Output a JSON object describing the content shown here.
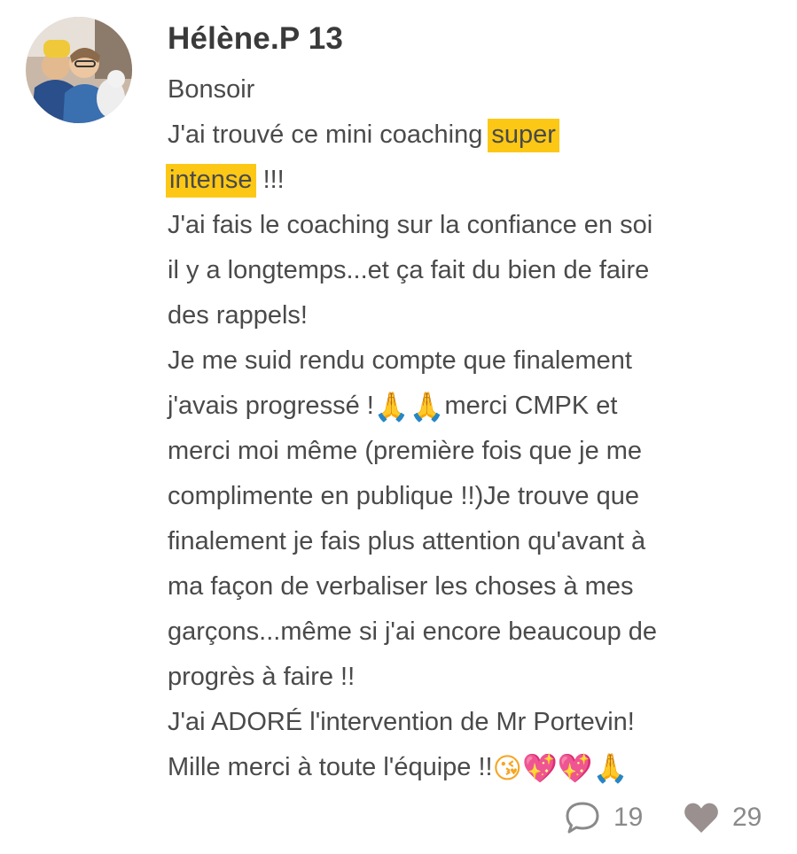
{
  "post": {
    "author": "Hélène.P 13",
    "lines": [
      {
        "segments": [
          {
            "text": "Bonsoir"
          }
        ]
      },
      {
        "segments": [
          {
            "text": "J'ai trouvé ce mini coaching "
          },
          {
            "text": "super",
            "highlight": true
          }
        ]
      },
      {
        "segments": [
          {
            "text": "intense",
            "highlight": true
          },
          {
            "text": " !!!"
          }
        ]
      },
      {
        "segments": [
          {
            "text": "J'ai fais le coaching sur la confiance en soi"
          }
        ]
      },
      {
        "segments": [
          {
            "text": "il y a longtemps...et ça fait du bien de faire"
          }
        ]
      },
      {
        "segments": [
          {
            "text": "des rappels!"
          }
        ]
      },
      {
        "segments": [
          {
            "text": "Je me suid rendu compte que finalement"
          }
        ]
      },
      {
        "segments": [
          {
            "text": "j'avais progressé !"
          },
          {
            "emoji": "pray",
            "char": "🙏"
          },
          {
            "emoji": "pray",
            "char": "🙏"
          },
          {
            "text": "merci CMPK et"
          }
        ]
      },
      {
        "segments": [
          {
            "text": "merci moi même (première fois que je me"
          }
        ]
      },
      {
        "segments": [
          {
            "text": "complimente en publique !!)Je trouve que"
          }
        ]
      },
      {
        "segments": [
          {
            "text": "finalement je fais plus attention qu'avant à"
          }
        ]
      },
      {
        "segments": [
          {
            "text": "ma façon de verbaliser les choses à mes"
          }
        ]
      },
      {
        "segments": [
          {
            "text": "garçons...même si j'ai encore beaucoup de"
          }
        ]
      },
      {
        "segments": [
          {
            "text": "progrès à faire !!"
          }
        ]
      },
      {
        "segments": [
          {
            "text": "J'ai ADORÉ l'intervention de Mr Portevin!"
          }
        ]
      },
      {
        "segments": [
          {
            "text": "Mille merci à toute l'équipe !!"
          },
          {
            "emoji": "kiss",
            "char": "😘"
          },
          {
            "emoji": "heart",
            "char": "💖"
          },
          {
            "emoji": "heart",
            "char": "💖"
          },
          {
            "emoji": "pray",
            "char": "🙏"
          }
        ]
      }
    ],
    "highlight_color": "#fcc815",
    "text_color": "#4a4a4a",
    "footer": {
      "comments_count": "19",
      "likes_count": "29",
      "comments_icon": "speech-bubble-icon",
      "likes_icon": "heart-icon",
      "icon_color": "#8a8a8a"
    }
  }
}
